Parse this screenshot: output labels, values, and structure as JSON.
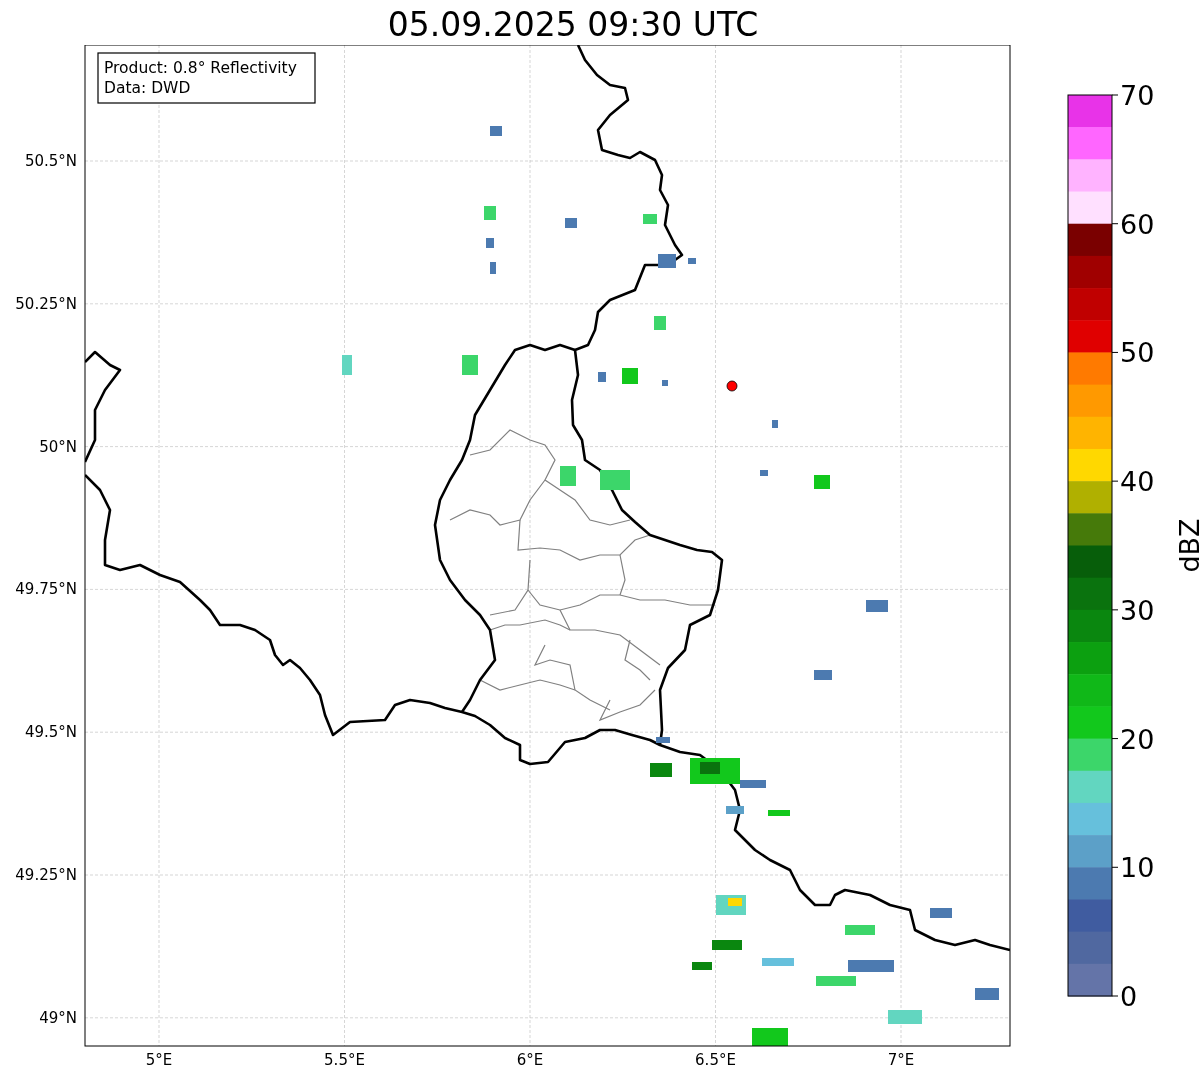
{
  "title": "05.09.2025 09:30 UTC",
  "info_box": [
    "Product: 0.8° Reflectivity",
    "Data: DWD"
  ],
  "map": {
    "x_tick_labels": [
      "5°E",
      "5.5°E",
      "6°E",
      "6.5°E",
      "7°E"
    ],
    "y_tick_labels": [
      "50.5°N",
      "50.25°N",
      "50°N",
      "49.75°N",
      "49.5°N",
      "49.25°N",
      "49°N"
    ]
  },
  "colorbar": {
    "label": "dBZ",
    "ticks": [
      "70",
      "60",
      "50",
      "40",
      "30",
      "20",
      "10",
      "0"
    ],
    "bins": [
      {
        "color": "#e833e8"
      },
      {
        "color": "#ff66ff"
      },
      {
        "color": "#ffb3ff"
      },
      {
        "color": "#ffe0ff"
      },
      {
        "color": "#7a0000"
      },
      {
        "color": "#a00000"
      },
      {
        "color": "#c00000"
      },
      {
        "color": "#e00000"
      },
      {
        "color": "#ff7a00"
      },
      {
        "color": "#ff9900"
      },
      {
        "color": "#ffb400"
      },
      {
        "color": "#ffd800"
      },
      {
        "color": "#b0b000"
      },
      {
        "color": "#467a0a"
      },
      {
        "color": "#075e0a"
      },
      {
        "color": "#0a730e"
      },
      {
        "color": "#0a870f"
      },
      {
        "color": "#0ca010"
      },
      {
        "color": "#10b818"
      },
      {
        "color": "#12c81c"
      },
      {
        "color": "#3cd66a"
      },
      {
        "color": "#62d6c0"
      },
      {
        "color": "#66c0dc"
      },
      {
        "color": "#5ca0c8"
      },
      {
        "color": "#4c7ab0"
      },
      {
        "color": "#405ca0"
      },
      {
        "color": "#5068a0"
      },
      {
        "color": "#6474a8"
      }
    ]
  }
}
